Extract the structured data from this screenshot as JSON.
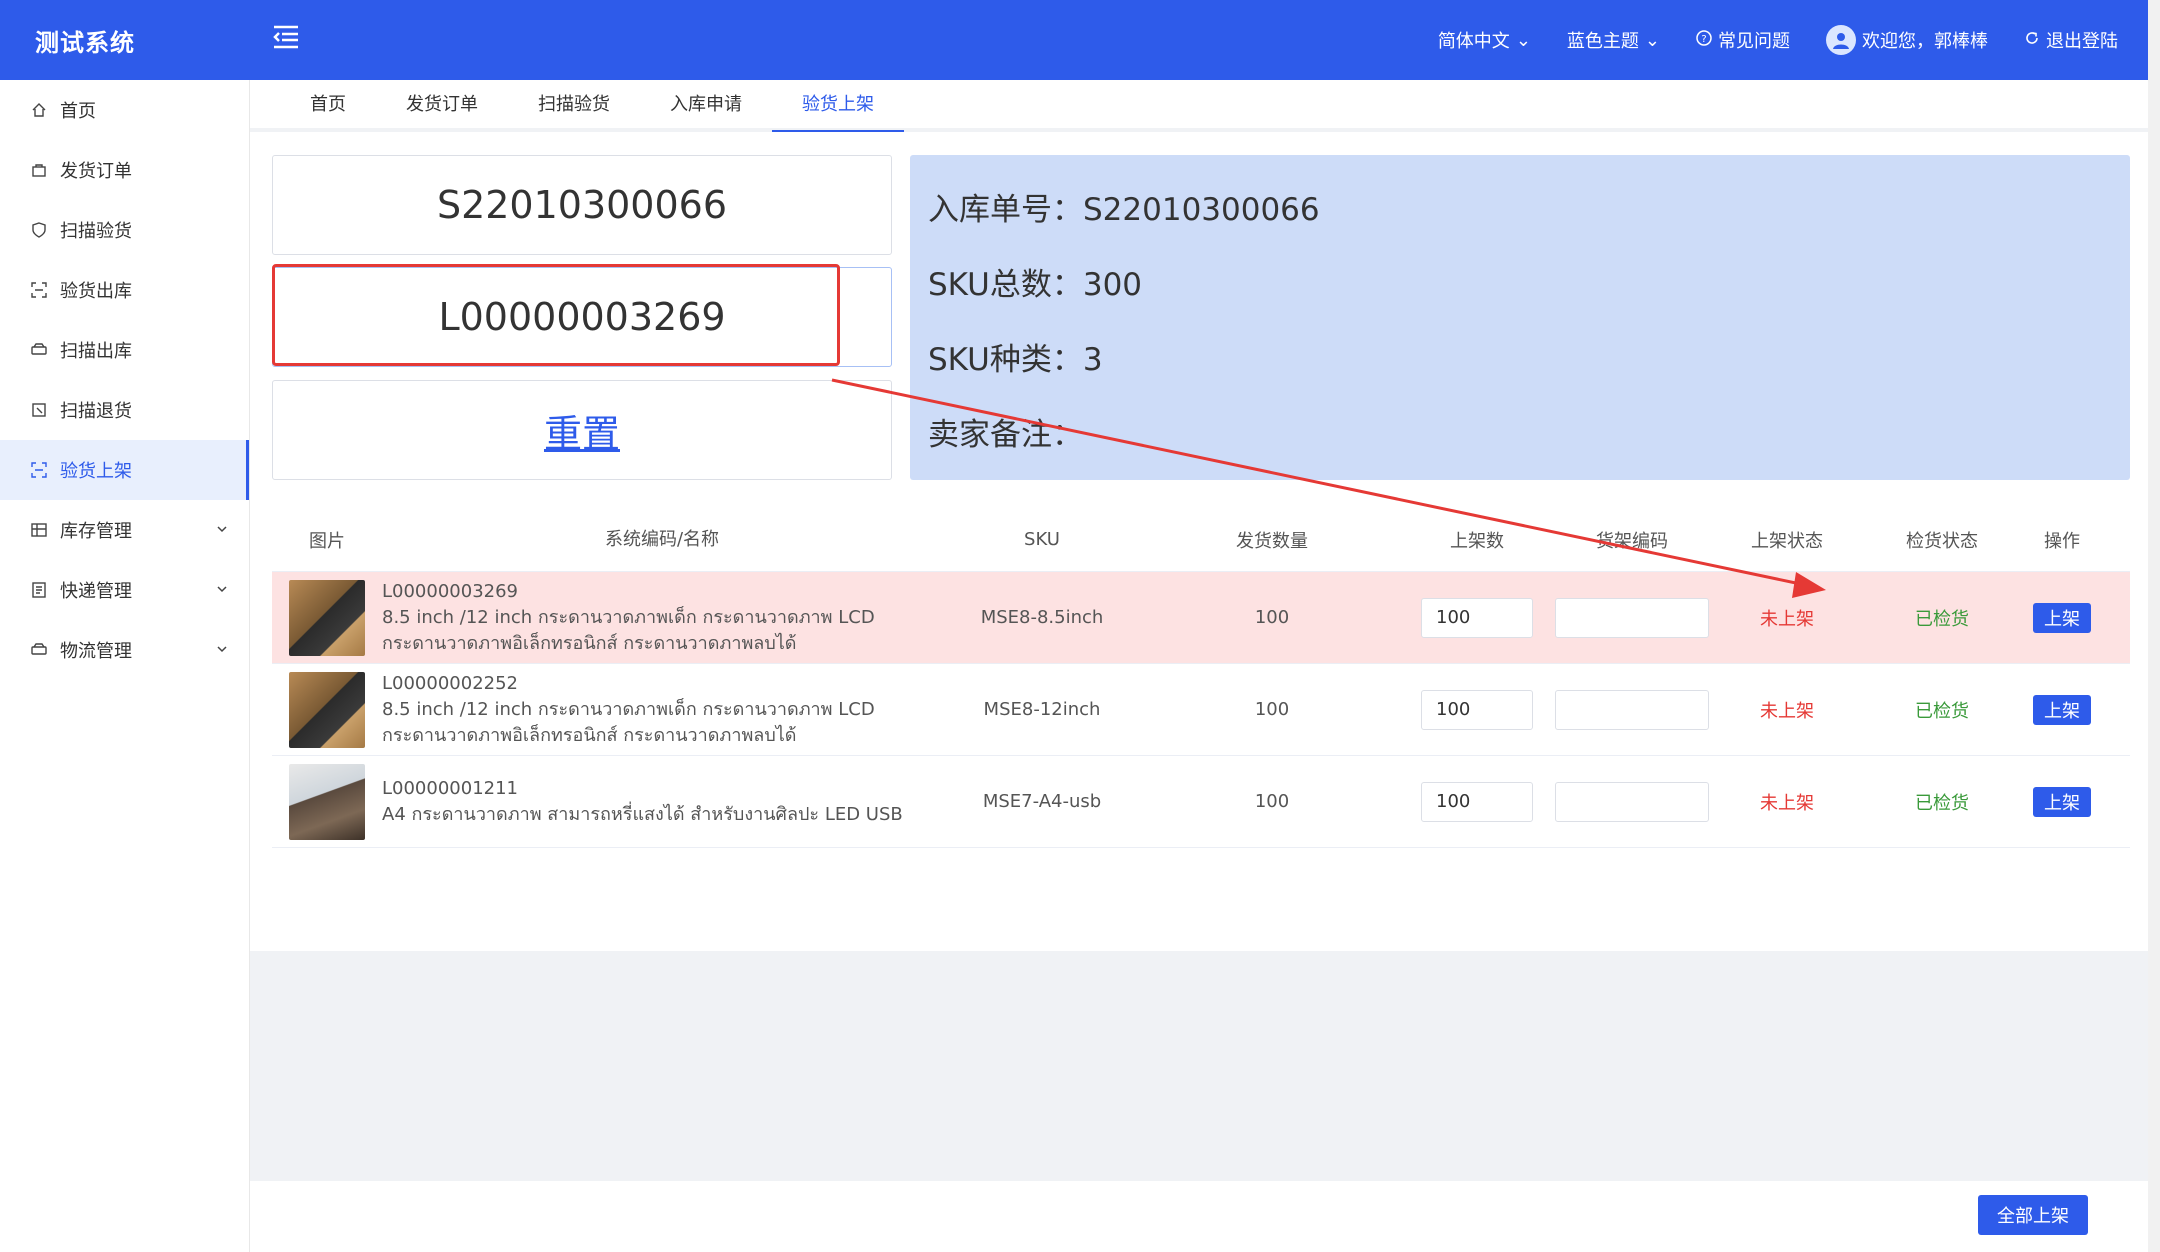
{
  "header": {
    "brand": "测试系统",
    "language": "简体中文",
    "theme": "蓝色主题",
    "faq": "常见问题",
    "welcome": "欢迎您，郭棒棒",
    "logout": "退出登陆",
    "color": "#2e5bea"
  },
  "sidebar": {
    "items": [
      {
        "label": "首页",
        "icon": "home-icon"
      },
      {
        "label": "发货订单",
        "icon": "bag-icon"
      },
      {
        "label": "扫描验货",
        "icon": "shield-icon"
      },
      {
        "label": "验货出库",
        "icon": "scan-icon"
      },
      {
        "label": "扫描出库",
        "icon": "truck-icon"
      },
      {
        "label": "扫描退货",
        "icon": "return-icon"
      },
      {
        "label": "验货上架",
        "icon": "scan-icon",
        "active": true
      },
      {
        "label": "库存管理",
        "icon": "grid-icon",
        "expandable": true
      },
      {
        "label": "快递管理",
        "icon": "list-icon",
        "expandable": true
      },
      {
        "label": "物流管理",
        "icon": "truck-icon",
        "expandable": true
      }
    ]
  },
  "tabs": [
    {
      "label": "首页"
    },
    {
      "label": "发货订单"
    },
    {
      "label": "扫描验货"
    },
    {
      "label": "入库申请"
    },
    {
      "label": "验货上架",
      "active": true
    }
  ],
  "scan": {
    "order_no": "S22010300066",
    "sku_no": "L00000003269",
    "reset": "重置"
  },
  "info": {
    "order_line": "入库单号：S22010300066",
    "sku_total_line": "SKU总数：300",
    "sku_kinds_line": "SKU种类：3",
    "remark_line": "卖家备注："
  },
  "table": {
    "headers": {
      "image": "图片",
      "code_name": "系统编码/名称",
      "sku": "SKU",
      "ship_qty": "发货数量",
      "shelf_qty": "上架数",
      "location": "货架编码",
      "shelf_status": "上架状态",
      "check_status": "检货状态",
      "op": "操作"
    },
    "rows": [
      {
        "code": "L00000003269",
        "name": "8.5 inch /12 inch กระดานวาดภาพเด็ก กระดานวาดภาพ LCD กระดานวาดภาพอิเล็กทรอนิกส์ กระดานวาดภาพลบได้",
        "sku": "MSE8-8.5inch",
        "ship_qty": "100",
        "shelf_qty": "100",
        "location": "",
        "shelf_status": "未上架",
        "check_status": "已检货",
        "op": "上架",
        "highlight": true
      },
      {
        "code": "L00000002252",
        "name": "8.5 inch /12 inch กระดานวาดภาพเด็ก กระดานวาดภาพ LCD กระดานวาดภาพอิเล็กทรอนิกส์ กระดานวาดภาพลบได้",
        "sku": "MSE8-12inch",
        "ship_qty": "100",
        "shelf_qty": "100",
        "location": "",
        "shelf_status": "未上架",
        "check_status": "已检货",
        "op": "上架"
      },
      {
        "code": "L00000001211",
        "name": "A4 กระดานวาดภาพ สามารถหรี่แสงได้ สำหรับงานศิลปะ LED USB",
        "sku": "MSE7-A4-usb",
        "ship_qty": "100",
        "shelf_qty": "100",
        "location": "",
        "shelf_status": "未上架",
        "check_status": "已检货",
        "op": "上架"
      }
    ]
  },
  "footer": {
    "shelf_all": "全部上架"
  }
}
